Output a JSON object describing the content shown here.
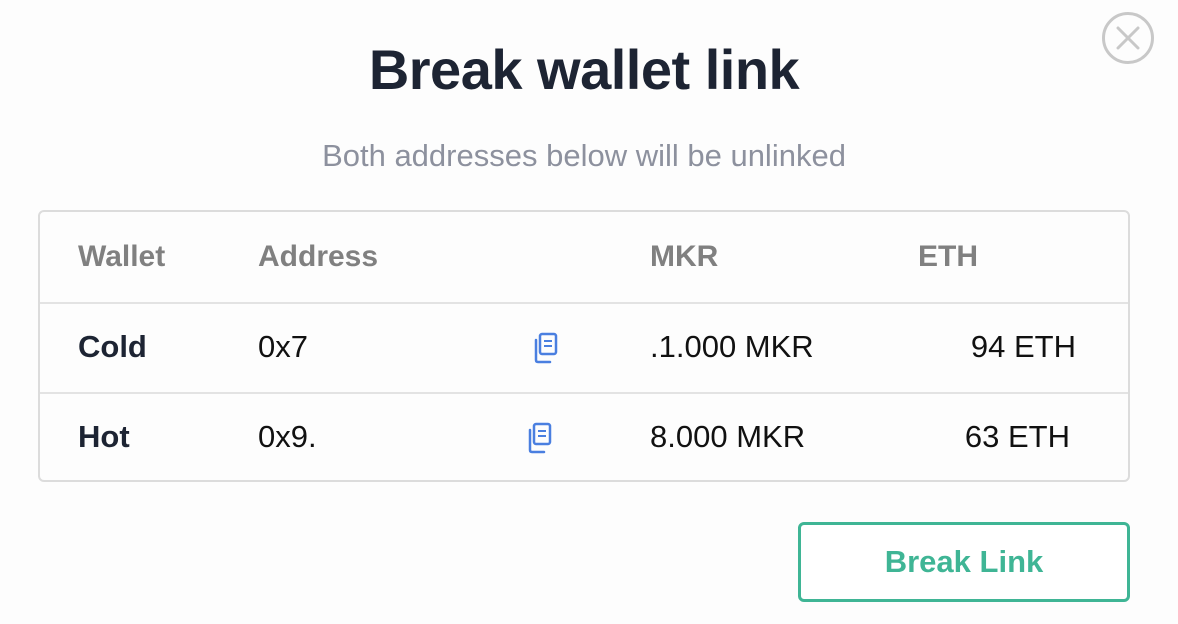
{
  "modal": {
    "title": "Break wallet link",
    "subtitle": "Both addresses below will be unlinked",
    "close_icon": "close-icon"
  },
  "table": {
    "headers": {
      "wallet": "Wallet",
      "address": "Address",
      "mkr": "MKR",
      "eth": "ETH"
    },
    "rows": [
      {
        "wallet": "Cold",
        "address": "0x7",
        "mkr": ".1.000 MKR",
        "eth": "94 ETH",
        "copy_icon": "copy-icon"
      },
      {
        "wallet": "Hot",
        "address": "0x9.",
        "mkr": "8.000 MKR",
        "eth": "63 ETH",
        "copy_icon": "copy-icon"
      }
    ]
  },
  "actions": {
    "break_link_label": "Break Link"
  },
  "colors": {
    "accent": "#3fb595",
    "copy_icon": "#4a7fe0",
    "title": "#1d2433",
    "subtitle": "#8d919e"
  }
}
